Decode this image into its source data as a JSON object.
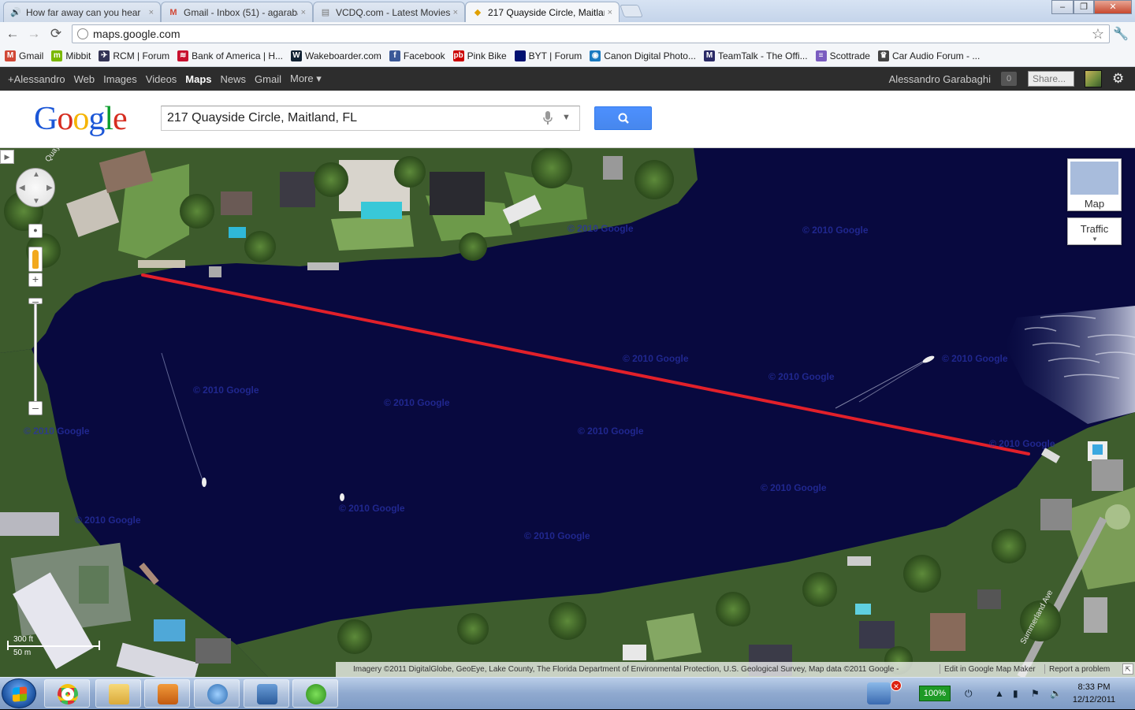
{
  "browser": {
    "tabs": [
      {
        "title": "How far away can you hear",
        "icon": "speaker-icon",
        "active": false
      },
      {
        "title": "Gmail - Inbox (51) - agaraba",
        "icon": "gmail-icon",
        "active": false
      },
      {
        "title": "VCDQ.com - Latest Movies,",
        "icon": "vcdq-icon",
        "active": false
      },
      {
        "title": "217 Quayside Circle, Maitlan",
        "icon": "maps-icon",
        "active": true
      }
    ],
    "close_glyph": "×",
    "url": "maps.google.com",
    "window_controls": [
      "–",
      "❐",
      "✕"
    ],
    "bookmarks": [
      {
        "label": "Gmail",
        "icon": "gmail-icon",
        "color": "#d14836",
        "glyph": "M"
      },
      {
        "label": "Mibbit",
        "icon": "mibbit-icon",
        "color": "#7ab800",
        "glyph": "m"
      },
      {
        "label": "RCM | Forum",
        "icon": "rcm-icon",
        "color": "#335",
        "glyph": "✈"
      },
      {
        "label": "Bank of America | H...",
        "icon": "bofa-icon",
        "color": "#c8102e",
        "glyph": "≋"
      },
      {
        "label": "Wakeboarder.com",
        "icon": "wakeboarder-icon",
        "color": "#123",
        "glyph": "W"
      },
      {
        "label": "Facebook",
        "icon": "facebook-icon",
        "color": "#3b5998",
        "glyph": "f"
      },
      {
        "label": "Pink Bike",
        "icon": "pinkbike-icon",
        "color": "#c00",
        "glyph": "pb"
      },
      {
        "label": "BYT | Forum",
        "icon": "byt-icon",
        "color": "#001070",
        "glyph": ""
      },
      {
        "label": "Canon Digital Photo...",
        "icon": "camera-icon",
        "color": "#1a7ac0",
        "glyph": "◉"
      },
      {
        "label": "TeamTalk - The Offi...",
        "icon": "teamtalk-icon",
        "color": "#2a2a66",
        "glyph": "M"
      },
      {
        "label": "Scottrade",
        "icon": "scottrade-icon",
        "color": "#7a5cc0",
        "glyph": "≡"
      },
      {
        "label": "Car Audio Forum - ...",
        "icon": "caraudio-icon",
        "color": "#444",
        "glyph": "♛"
      }
    ]
  },
  "gbar": {
    "items": [
      "+Alessandro",
      "Web",
      "Images",
      "Videos",
      "Maps",
      "News",
      "Gmail",
      "More ▾"
    ],
    "active": "Maps",
    "user": "Alessandro Garabaghi",
    "notifications": "0",
    "share": "Share..."
  },
  "search": {
    "logo": "Google",
    "query": "217 Quayside Circle, Maitland, FL"
  },
  "map": {
    "watermark": "© 2010 Google",
    "map_button": "Map",
    "traffic_button": "Traffic",
    "scale_feet": "300 ft",
    "scale_meters": "50 m",
    "street_label": "Summerland Ave",
    "street_label_2": "Quay",
    "attribution": "Imagery ©2011 DigitalGlobe, GeoEye, Lake County, The Florida Department of Environmental Protection, U.S. Geological Survey, Map data ©2011 Google -",
    "edit_link": "Edit in Google Map Maker",
    "report_link": "Report a problem",
    "line_color": "#e2202a"
  },
  "taskbar": {
    "battery": "100%",
    "time": "8:33 PM",
    "date": "12/12/2011",
    "badge": "✕"
  }
}
